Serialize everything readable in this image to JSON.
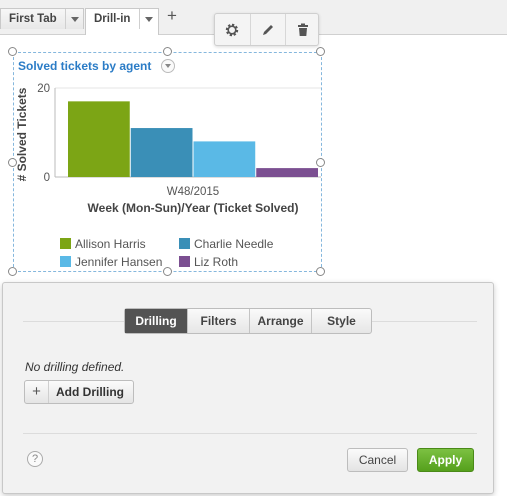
{
  "tabs": [
    {
      "label": "First Tab"
    },
    {
      "label": "Drill-in"
    }
  ],
  "toolbar": {
    "icons": [
      "gear-icon",
      "pencil-icon",
      "trash-icon"
    ]
  },
  "widget": {
    "title": "Solved tickets by agent",
    "colors": [
      "#7ca515",
      "#3a8fb7",
      "#5ab9e6",
      "#7b4f91"
    ]
  },
  "chart_data": {
    "type": "bar",
    "categories": [
      "W48/2015"
    ],
    "series": [
      {
        "name": "Allison Harris",
        "values": [
          17
        ]
      },
      {
        "name": "Charlie Needle",
        "values": [
          11
        ]
      },
      {
        "name": "Jennifer Hansen",
        "values": [
          8
        ]
      },
      {
        "name": "Liz Roth",
        "values": [
          2
        ]
      }
    ],
    "xlabel": "Week (Mon-Sun)/Year (Ticket Solved)",
    "ylabel": "# Solved Tickets",
    "yticks": [
      "20",
      "0"
    ],
    "ylim": [
      0,
      20
    ],
    "legend": "bottom"
  },
  "panel": {
    "tabs": [
      "Drilling",
      "Filters",
      "Arrange",
      "Style"
    ],
    "active_tab": "Drilling",
    "empty_text": "No drilling defined.",
    "add_label": "Add Drilling",
    "add_symbol": "+",
    "help_symbol": "?",
    "cancel_label": "Cancel",
    "apply_label": "Apply"
  }
}
